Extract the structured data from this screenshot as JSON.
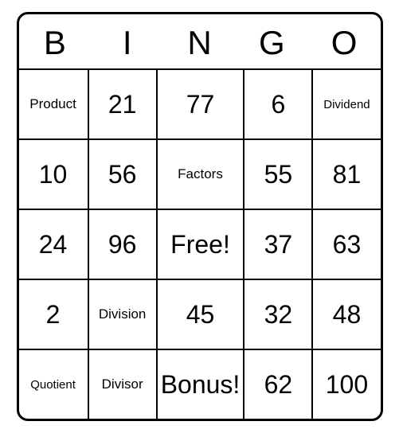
{
  "header": [
    "B",
    "I",
    "N",
    "G",
    "O"
  ],
  "cells": [
    {
      "text": "Product",
      "cls": "word"
    },
    {
      "text": "21",
      "cls": "num"
    },
    {
      "text": "77",
      "cls": "num"
    },
    {
      "text": "6",
      "cls": "num"
    },
    {
      "text": "Dividend",
      "cls": "word-sm"
    },
    {
      "text": "10",
      "cls": "num"
    },
    {
      "text": "56",
      "cls": "num"
    },
    {
      "text": "Factors",
      "cls": "word"
    },
    {
      "text": "55",
      "cls": "num"
    },
    {
      "text": "81",
      "cls": "num"
    },
    {
      "text": "24",
      "cls": "num"
    },
    {
      "text": "96",
      "cls": "num"
    },
    {
      "text": "Free!",
      "cls": "num"
    },
    {
      "text": "37",
      "cls": "num"
    },
    {
      "text": "63",
      "cls": "num"
    },
    {
      "text": "2",
      "cls": "num"
    },
    {
      "text": "Division",
      "cls": "word"
    },
    {
      "text": "45",
      "cls": "num"
    },
    {
      "text": "32",
      "cls": "num"
    },
    {
      "text": "48",
      "cls": "num"
    },
    {
      "text": "Quotient",
      "cls": "word-sm"
    },
    {
      "text": "Divisor",
      "cls": "word"
    },
    {
      "text": "Bonus!",
      "cls": "num"
    },
    {
      "text": "62",
      "cls": "num"
    },
    {
      "text": "100",
      "cls": "num"
    }
  ]
}
